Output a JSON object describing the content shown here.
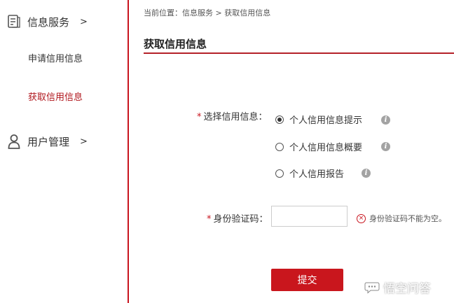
{
  "sidebar": {
    "sections": [
      {
        "icon": "document-icon",
        "label": "信息服务",
        "chevron": ">",
        "items": [
          {
            "label": "申请信用信息",
            "active": false
          },
          {
            "label": "获取信用信息",
            "active": true
          }
        ]
      },
      {
        "icon": "user-icon",
        "label": "用户管理",
        "chevron": ">"
      }
    ]
  },
  "main": {
    "breadcrumb": "当前位置：信息服务 > 获取信用信息",
    "title": "获取信用信息",
    "form": {
      "credit_field": {
        "required_mark": "*",
        "label": "选择信用信息：",
        "options": [
          {
            "label": "个人信用信息提示",
            "checked": true
          },
          {
            "label": "个人信用信息概要",
            "checked": false
          },
          {
            "label": "个人信用报告",
            "checked": false
          }
        ],
        "info_glyph": "i"
      },
      "id_field": {
        "required_mark": "*",
        "label": "身份验证码：",
        "value": "",
        "error": "身份验证码不能为空。",
        "error_glyph": "×"
      },
      "submit_label": "提交"
    }
  },
  "watermark": {
    "text": "悟空问答",
    "icon": "chat-bubble-icon"
  },
  "colors": {
    "accent": "#c8141e",
    "active_nav": "#b0161c",
    "button": "#c9161d"
  }
}
